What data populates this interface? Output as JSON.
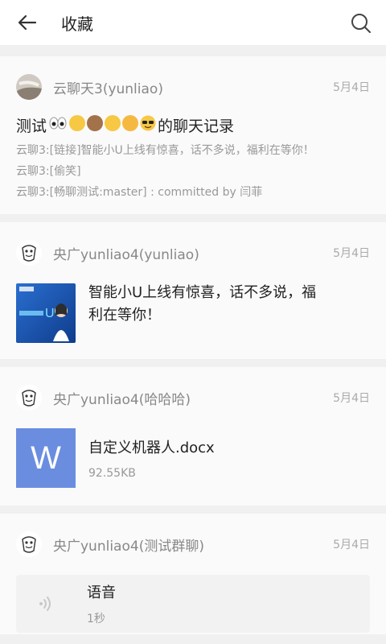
{
  "header": {
    "title": "收藏",
    "back_icon": "back-arrow-icon",
    "search_icon": "search-icon"
  },
  "items": [
    {
      "sender": "云聊天3(yunliao)",
      "date": "5月4日",
      "title_prefix": "测试",
      "title_suffix": "的聊天记录",
      "lines": [
        "云聊3:[链接]智能小U上线有惊喜，话不多说，福利在等你！",
        "云聊3:[偷笑]",
        "云聊3:[畅聊测试:master] : committed by 闫菲"
      ]
    },
    {
      "sender": "央广yunliao4(yunliao)",
      "date": "5月4日",
      "link_text": "智能小U上线有惊喜，话不多说，福利在等你！"
    },
    {
      "sender": "央广yunliao4(哈哈哈)",
      "date": "5月4日",
      "file_letter": "W",
      "file_name": "自定义机器人.docx",
      "file_size": "92.55KB"
    },
    {
      "sender": "央广yunliao4(测试群聊)",
      "date": "5月4日",
      "voice_title": "语音",
      "voice_duration": "1秒"
    }
  ],
  "colors": {
    "file_blue": "#6b8de0",
    "card_bg": "#fafafa",
    "page_bg": "#f0f0f0"
  }
}
